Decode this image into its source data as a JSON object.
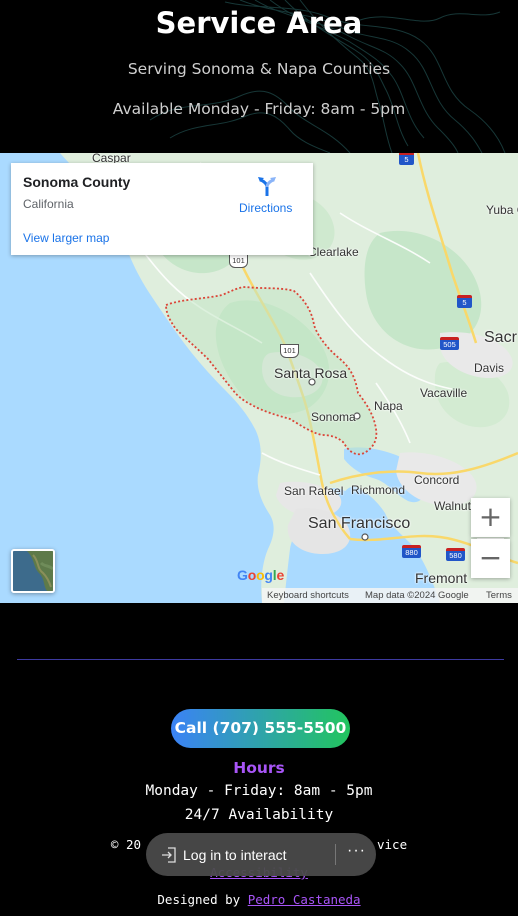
{
  "header": {
    "title": "Service Area",
    "subtitle": "Serving Sonoma & Napa Counties",
    "availability": "Available Monday - Friday: 8am - 5pm"
  },
  "map": {
    "card": {
      "title": "Sonoma County",
      "subtitle": "California",
      "directions_label": "Directions",
      "larger_map_label": "View larger map"
    },
    "places": {
      "caspar": "Caspar",
      "clearlake": "Clearlake",
      "yuba_city": "Yuba C",
      "sacramento": "Sacr",
      "davis": "Davis",
      "santa_rosa": "Santa Rosa",
      "napa": "Napa",
      "vacaville": "Vacaville",
      "sonoma": "Sonoma",
      "san_rafael": "San Rafael",
      "richmond": "Richmond",
      "concord": "Concord",
      "walnut": "Walnut",
      "san_francisco": "San Francisco",
      "fremont": "Fremont"
    },
    "shields": {
      "us101_north": "101",
      "us101_south": "101",
      "i5_north": "5",
      "i5_mid": "5",
      "i505": "505",
      "i880": "880",
      "i580": "580"
    },
    "zoom_in": "+",
    "zoom_out": "−",
    "google_logo": [
      "G",
      "o",
      "o",
      "g",
      "l",
      "e"
    ],
    "google_colors": [
      "#4285f4",
      "#ea4335",
      "#fbbc05",
      "#4285f4",
      "#34a853",
      "#ea4335"
    ],
    "attribution": {
      "shortcuts": "Keyboard shortcuts",
      "data": "Map data ©2024 Google",
      "terms": "Terms"
    },
    "colors": {
      "water": "#aadaff",
      "land": "#dfeedd",
      "park": "#bfe2c4",
      "boundary": "#db4437",
      "link": "#1a73e8"
    }
  },
  "footer": {
    "call_label": "Call (707) 555-5500",
    "hours_heading": "Hours",
    "hours_line1": "Monday - Friday: 8am - 5pm",
    "hours_line2": "24/7 Availability",
    "copyright": "© 20",
    "copyright_tail": "vice",
    "accessibility": "Accessibility",
    "designed_prefix": "Designed by ",
    "designer": "Pedro Castaneda",
    "accent": "#a855f7",
    "button_gradient": [
      "#3b82f6",
      "#22c55e"
    ]
  },
  "toast": {
    "label": "Log in to interact",
    "more": "···"
  }
}
